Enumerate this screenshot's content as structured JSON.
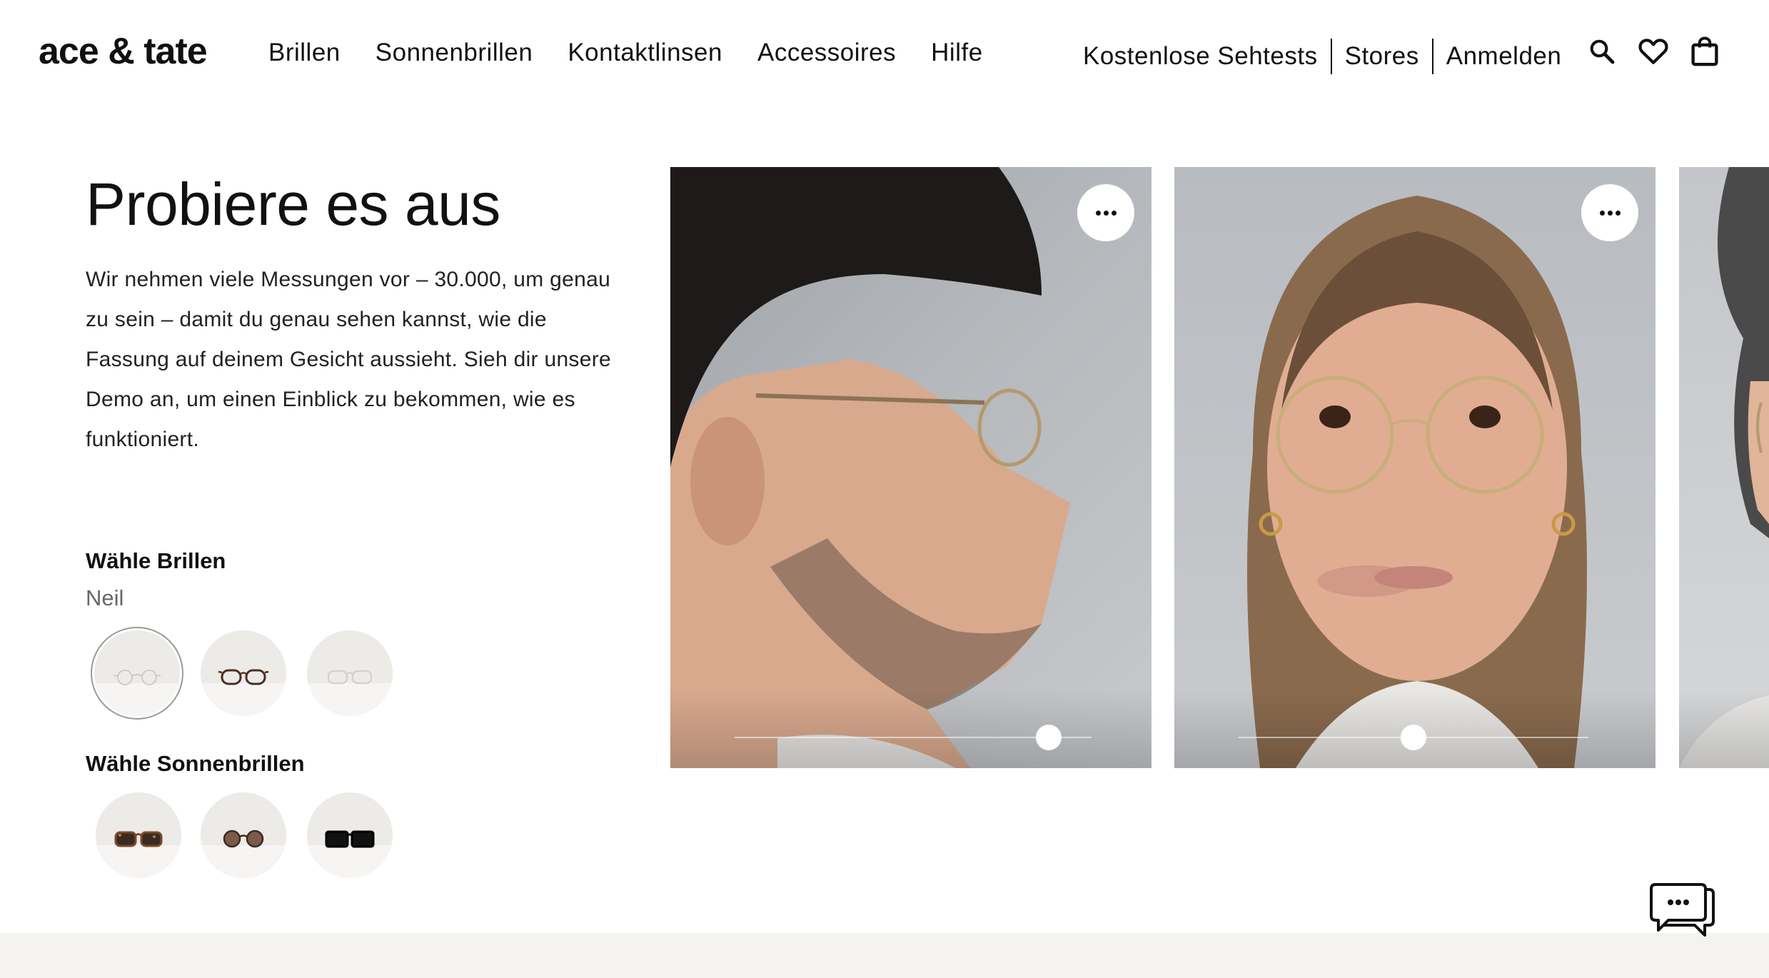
{
  "header": {
    "logo": "ace & tate",
    "nav": [
      {
        "label": "Brillen"
      },
      {
        "label": "Sonnenbrillen"
      },
      {
        "label": "Kontaktlinsen"
      },
      {
        "label": "Accessoires"
      },
      {
        "label": "Hilfe"
      }
    ],
    "secondary_nav": [
      {
        "label": "Kostenlose Sehtests"
      },
      {
        "label": "Stores"
      },
      {
        "label": "Anmelden"
      }
    ],
    "icons": [
      "search-icon",
      "heart-icon",
      "shopping-bag-icon"
    ]
  },
  "main": {
    "title": "Probiere es aus",
    "intro": "Wir nehmen viele Messungen vor – 30.000, um genau zu sein – damit du genau sehen kannst, wie die Fassung auf deinem Gesicht aussieht. Sieh dir unsere Demo an, um einen Einblick zu bekommen, wie es funktioniert.",
    "glasses_section": {
      "label": "Wähle Brillen",
      "selected_name": "Neil",
      "options": [
        {
          "icon": "clear-glasses-icon",
          "selected": true
        },
        {
          "icon": "brown-glasses-icon",
          "selected": false
        },
        {
          "icon": "transparent-glasses-icon",
          "selected": false
        }
      ]
    },
    "sunglasses_section": {
      "label": "Wähle Sonnenbrillen",
      "options": [
        {
          "icon": "tortoise-sunglasses-icon"
        },
        {
          "icon": "brown-sunglasses-icon"
        },
        {
          "icon": "black-sunglasses-icon"
        }
      ]
    }
  },
  "cards": [
    {
      "name": "profile-view-card",
      "slider_value": 0.88
    },
    {
      "name": "front-view-card",
      "slider_value": 0.5
    },
    {
      "name": "partial-card"
    }
  ],
  "colors": {
    "text": "#111111",
    "muted": "#666666",
    "footer_band": "#f4f3f0",
    "swatch_bg": "#ecebe8"
  }
}
